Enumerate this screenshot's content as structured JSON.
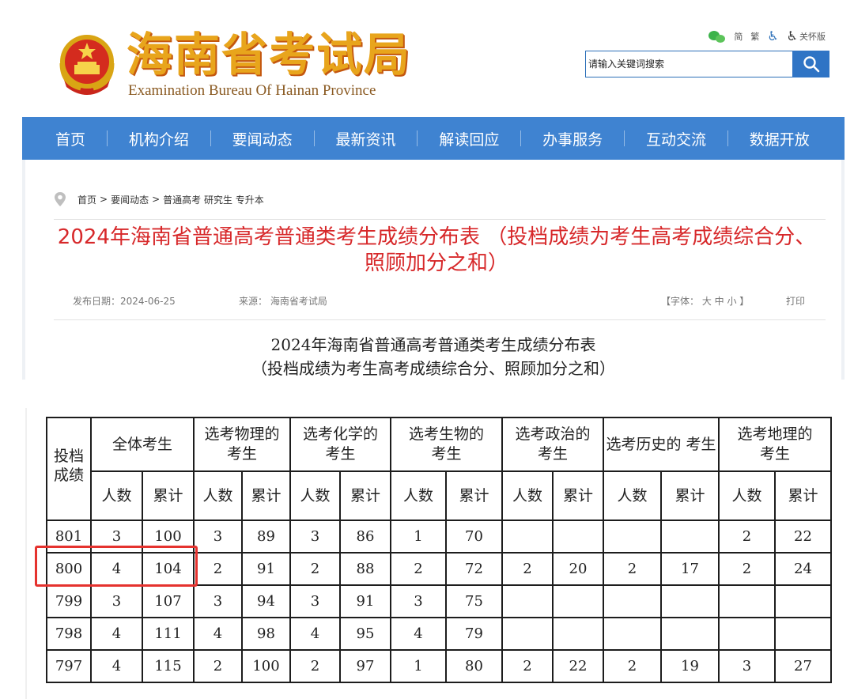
{
  "header": {
    "logo_cn": "海南省考试局",
    "logo_en": "Examination Bureau Of Hainan Province",
    "tools": {
      "simplified": "简",
      "traditional": "繁",
      "care": "关怀版"
    },
    "search_placeholder": "请输入关键词搜索"
  },
  "nav": [
    "首页",
    "机构介绍",
    "要闻动态",
    "最新资讯",
    "解读回应",
    "办事服务",
    "互动交流",
    "数据开放"
  ],
  "breadcrumb": {
    "home": "首页",
    "sep": ">",
    "section": "要闻动态",
    "sub": "普通高考 研究生 专升本"
  },
  "article": {
    "title": "2024年海南省普通高考普通类考生成绩分布表 （投档成绩为考生高考成绩综合分、照顾加分之和）",
    "date": "发布日期：2024-06-25",
    "source": "来源：  海南省考试局",
    "font_size": "【字体：  大  中  小  】",
    "print": "打印",
    "subtitle_line1": "2024年海南省普通高考普通类考生成绩分布表",
    "subtitle_line2": "（投档成绩为考生高考成绩综合分、照顾加分之和）"
  },
  "table": {
    "first_header": "投档成绩",
    "groups": [
      "全体考生",
      "选考物理的考生",
      "选考化学的考生",
      "选考生物的考生",
      "选考政治的考生",
      "选考历史的 考生",
      "选考地理的考生"
    ],
    "subheaders": [
      "人数",
      "累计"
    ],
    "rows": [
      [
        "801",
        "3",
        "100",
        "3",
        "89",
        "3",
        "86",
        "1",
        "70",
        "",
        "",
        "",
        "",
        "2",
        "22"
      ],
      [
        "800",
        "4",
        "104",
        "2",
        "91",
        "2",
        "88",
        "2",
        "72",
        "2",
        "20",
        "2",
        "17",
        "2",
        "24"
      ],
      [
        "799",
        "3",
        "107",
        "3",
        "94",
        "3",
        "91",
        "3",
        "75",
        "",
        "",
        "",
        "",
        "",
        ""
      ],
      [
        "798",
        "4",
        "111",
        "4",
        "98",
        "4",
        "95",
        "4",
        "79",
        "",
        "",
        "",
        "",
        "",
        ""
      ],
      [
        "797",
        "4",
        "115",
        "2",
        "100",
        "2",
        "97",
        "1",
        "80",
        "2",
        "22",
        "2",
        "19",
        "3",
        "27"
      ]
    ]
  },
  "colors": {
    "nav_bg": "#3f83d1",
    "title_red": "#d7282a",
    "highlight": "#e5322e",
    "logo_gold": "#e8a51c"
  }
}
